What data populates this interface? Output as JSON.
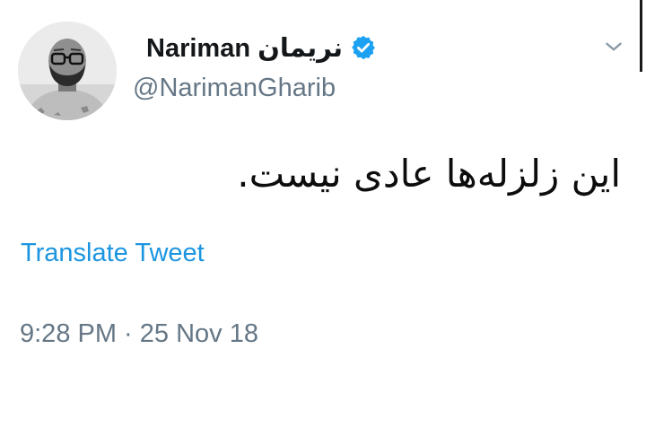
{
  "tweet": {
    "display_name": "Nariman نریمان",
    "handle": "@NarimanGharib",
    "text": "این زلزله‌ها عادی نیست.",
    "translate_label": "Translate Tweet",
    "timestamp": "9:28 PM · 25 Nov 18"
  },
  "icons": {
    "verified": "verified-badge-icon",
    "menu": "chevron-down-icon",
    "avatar": "profile-avatar"
  },
  "colors": {
    "link_blue": "#1b95e0",
    "secondary_text": "#657786",
    "verified_blue": "#1da1f2"
  }
}
